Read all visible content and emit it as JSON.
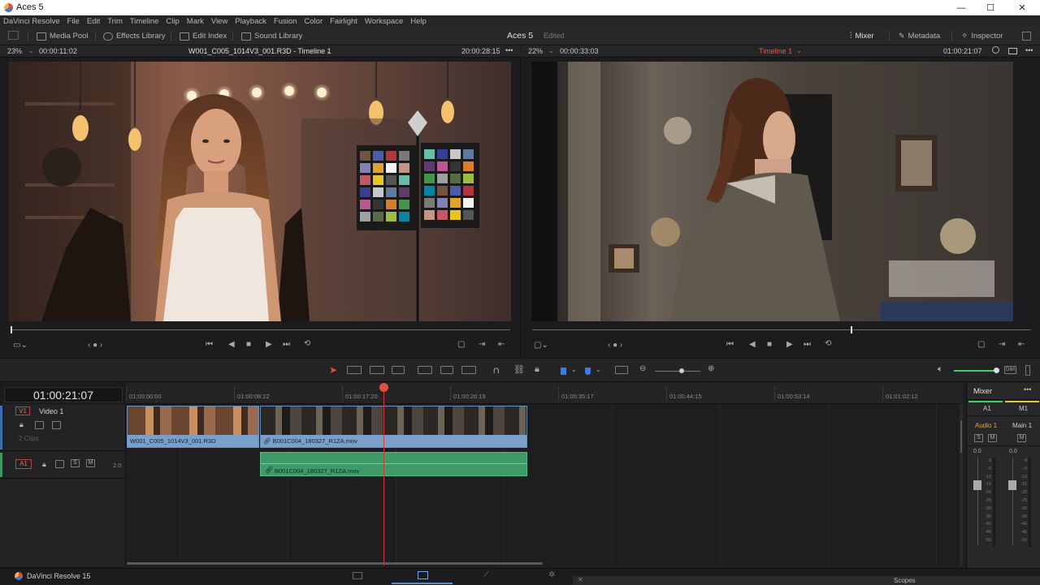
{
  "window": {
    "title": "Aces 5",
    "minimize": "—",
    "maximize": "☐",
    "close": "✕"
  },
  "menu": [
    "DaVinci Resolve",
    "File",
    "Edit",
    "Trim",
    "Timeline",
    "Clip",
    "Mark",
    "View",
    "Playback",
    "Fusion",
    "Color",
    "Fairlight",
    "Workspace",
    "Help"
  ],
  "toolbar": {
    "media_pool": "Media Pool",
    "effects_library": "Effects Library",
    "edit_index": "Edit Index",
    "sound_library": "Sound Library",
    "project_name": "Aces 5",
    "project_status": "Edited",
    "mixer": "Mixer",
    "metadata": "Metadata",
    "inspector": "Inspector"
  },
  "source_viewer": {
    "zoom": "23%",
    "duration": "00:00:11:02",
    "clip_name": "W001_C005_1014V3_001.R3D - Timeline 1",
    "timecode": "20:00:28:15"
  },
  "timeline_viewer": {
    "zoom": "22%",
    "duration": "00:00:33:03",
    "timeline_name": "Timeline 1",
    "timecode": "01:00:21:07"
  },
  "timeline": {
    "current_timecode": "01:00:21:07",
    "ruler": [
      "01:00:00:00",
      "01:00:08:22",
      "01:00:17:20",
      "01:00:26:19",
      "01:00:35:17",
      "01:00:44:15",
      "01:00:53:14",
      "01:01:02:12"
    ],
    "video_track": {
      "id": "V1",
      "name": "Video 1",
      "clip_count": "2 Clips"
    },
    "audio_track": {
      "id": "A1",
      "level": "2.0",
      "solo": "S",
      "mute": "M"
    },
    "clips": {
      "video1": "W001_C005_1014V3_001.R3D",
      "video2": "B001C004_180327_R1ZA.mov",
      "audio1": "B001C004_180327_R1ZA.mov"
    }
  },
  "mixer": {
    "title": "Mixer",
    "channels": [
      "A1",
      "M1"
    ],
    "names": [
      "Audio 1",
      "Main 1"
    ],
    "solo": "S",
    "mute": "M",
    "levels": [
      "0.0",
      "0.0"
    ],
    "scale": [
      "0",
      "-5",
      "-10",
      "-15",
      "-20",
      "-25",
      "-30",
      "-35",
      "-40",
      "-45",
      "-50"
    ]
  },
  "bottom": {
    "app_name": "DaVinci Resolve 15",
    "scopes": "Scopes"
  },
  "colors": {
    "accent_red": "#e05a4b",
    "clip_blue": "#7aa0c9",
    "clip_green": "#3e9a68",
    "playhead": "#d03a3a"
  }
}
